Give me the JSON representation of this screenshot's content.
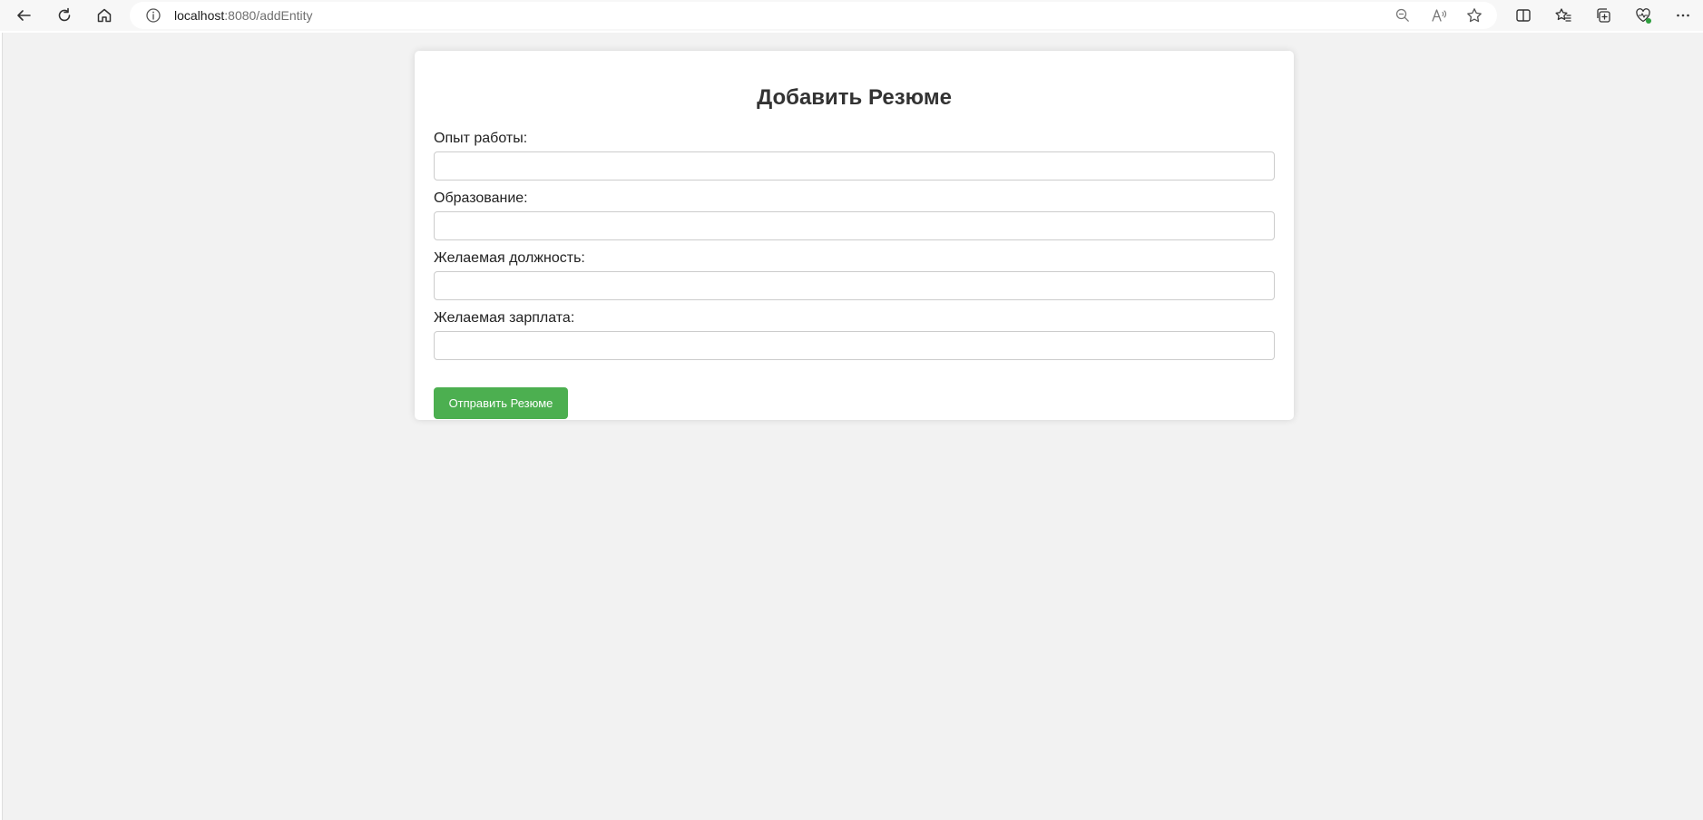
{
  "browser": {
    "url_host": "localhost",
    "url_rest": ":8080/addEntity",
    "icons": [
      "back-icon",
      "refresh-icon",
      "home-icon",
      "site-info-icon",
      "zoom-out-icon",
      "read-aloud-icon",
      "favorite-star-icon",
      "split-screen-icon",
      "favorites-icon",
      "collections-icon",
      "browser-essentials-icon",
      "more-icon"
    ]
  },
  "form": {
    "title": "Добавить Резюме",
    "fields": [
      {
        "label": "Опыт работы:",
        "value": ""
      },
      {
        "label": "Образование:",
        "value": ""
      },
      {
        "label": "Желаемая должность:",
        "value": ""
      },
      {
        "label": "Желаемая зарплата:",
        "value": ""
      }
    ],
    "submit_label": "Отправить Резюме"
  },
  "colors": {
    "page_background": "#f2f2f2",
    "card_background": "#ffffff",
    "submit_button": "#4caf50",
    "title_text": "#333333"
  }
}
